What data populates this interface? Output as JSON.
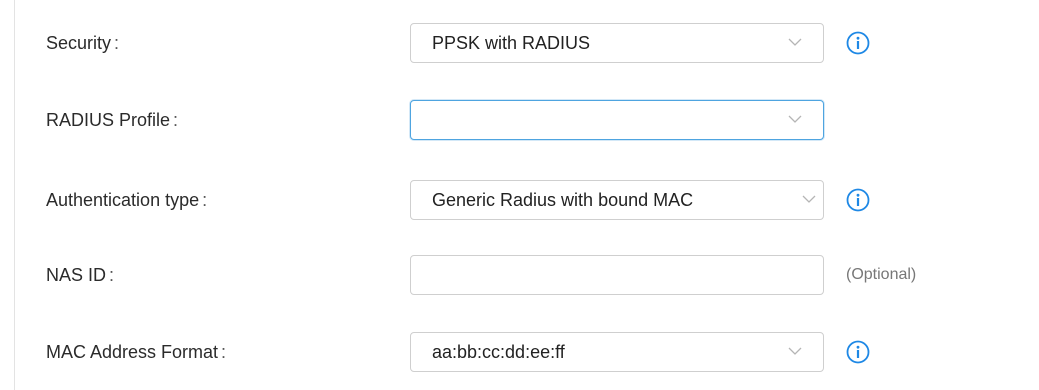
{
  "form": {
    "security": {
      "label": "Security",
      "colon": ":",
      "value": "PPSK with RADIUS",
      "dropdown_icon": "chevron-down-icon",
      "info_icon": "info-icon"
    },
    "radius_profile": {
      "label": "RADIUS Profile",
      "colon": ":",
      "value": "",
      "dropdown_icon": "chevron-down-icon"
    },
    "authentication_type": {
      "label": "Authentication type",
      "colon": ":",
      "value": "Generic Radius with bound MAC",
      "dropdown_icon": "chevron-down-icon",
      "info_icon": "info-icon"
    },
    "nas_id": {
      "label": "NAS ID",
      "colon": ":",
      "value": "",
      "placeholder": "",
      "hint": "(Optional)"
    },
    "mac_address_format": {
      "label": "MAC Address Format",
      "colon": ":",
      "value": "aa:bb:cc:dd:ee:ff",
      "dropdown_icon": "chevron-down-icon",
      "info_icon": "info-icon"
    }
  },
  "colors": {
    "info_accent": "#1e88e5",
    "focus_border": "#4ea4e0",
    "field_border": "#cfcfcf",
    "label_text": "#2b2b2b"
  }
}
